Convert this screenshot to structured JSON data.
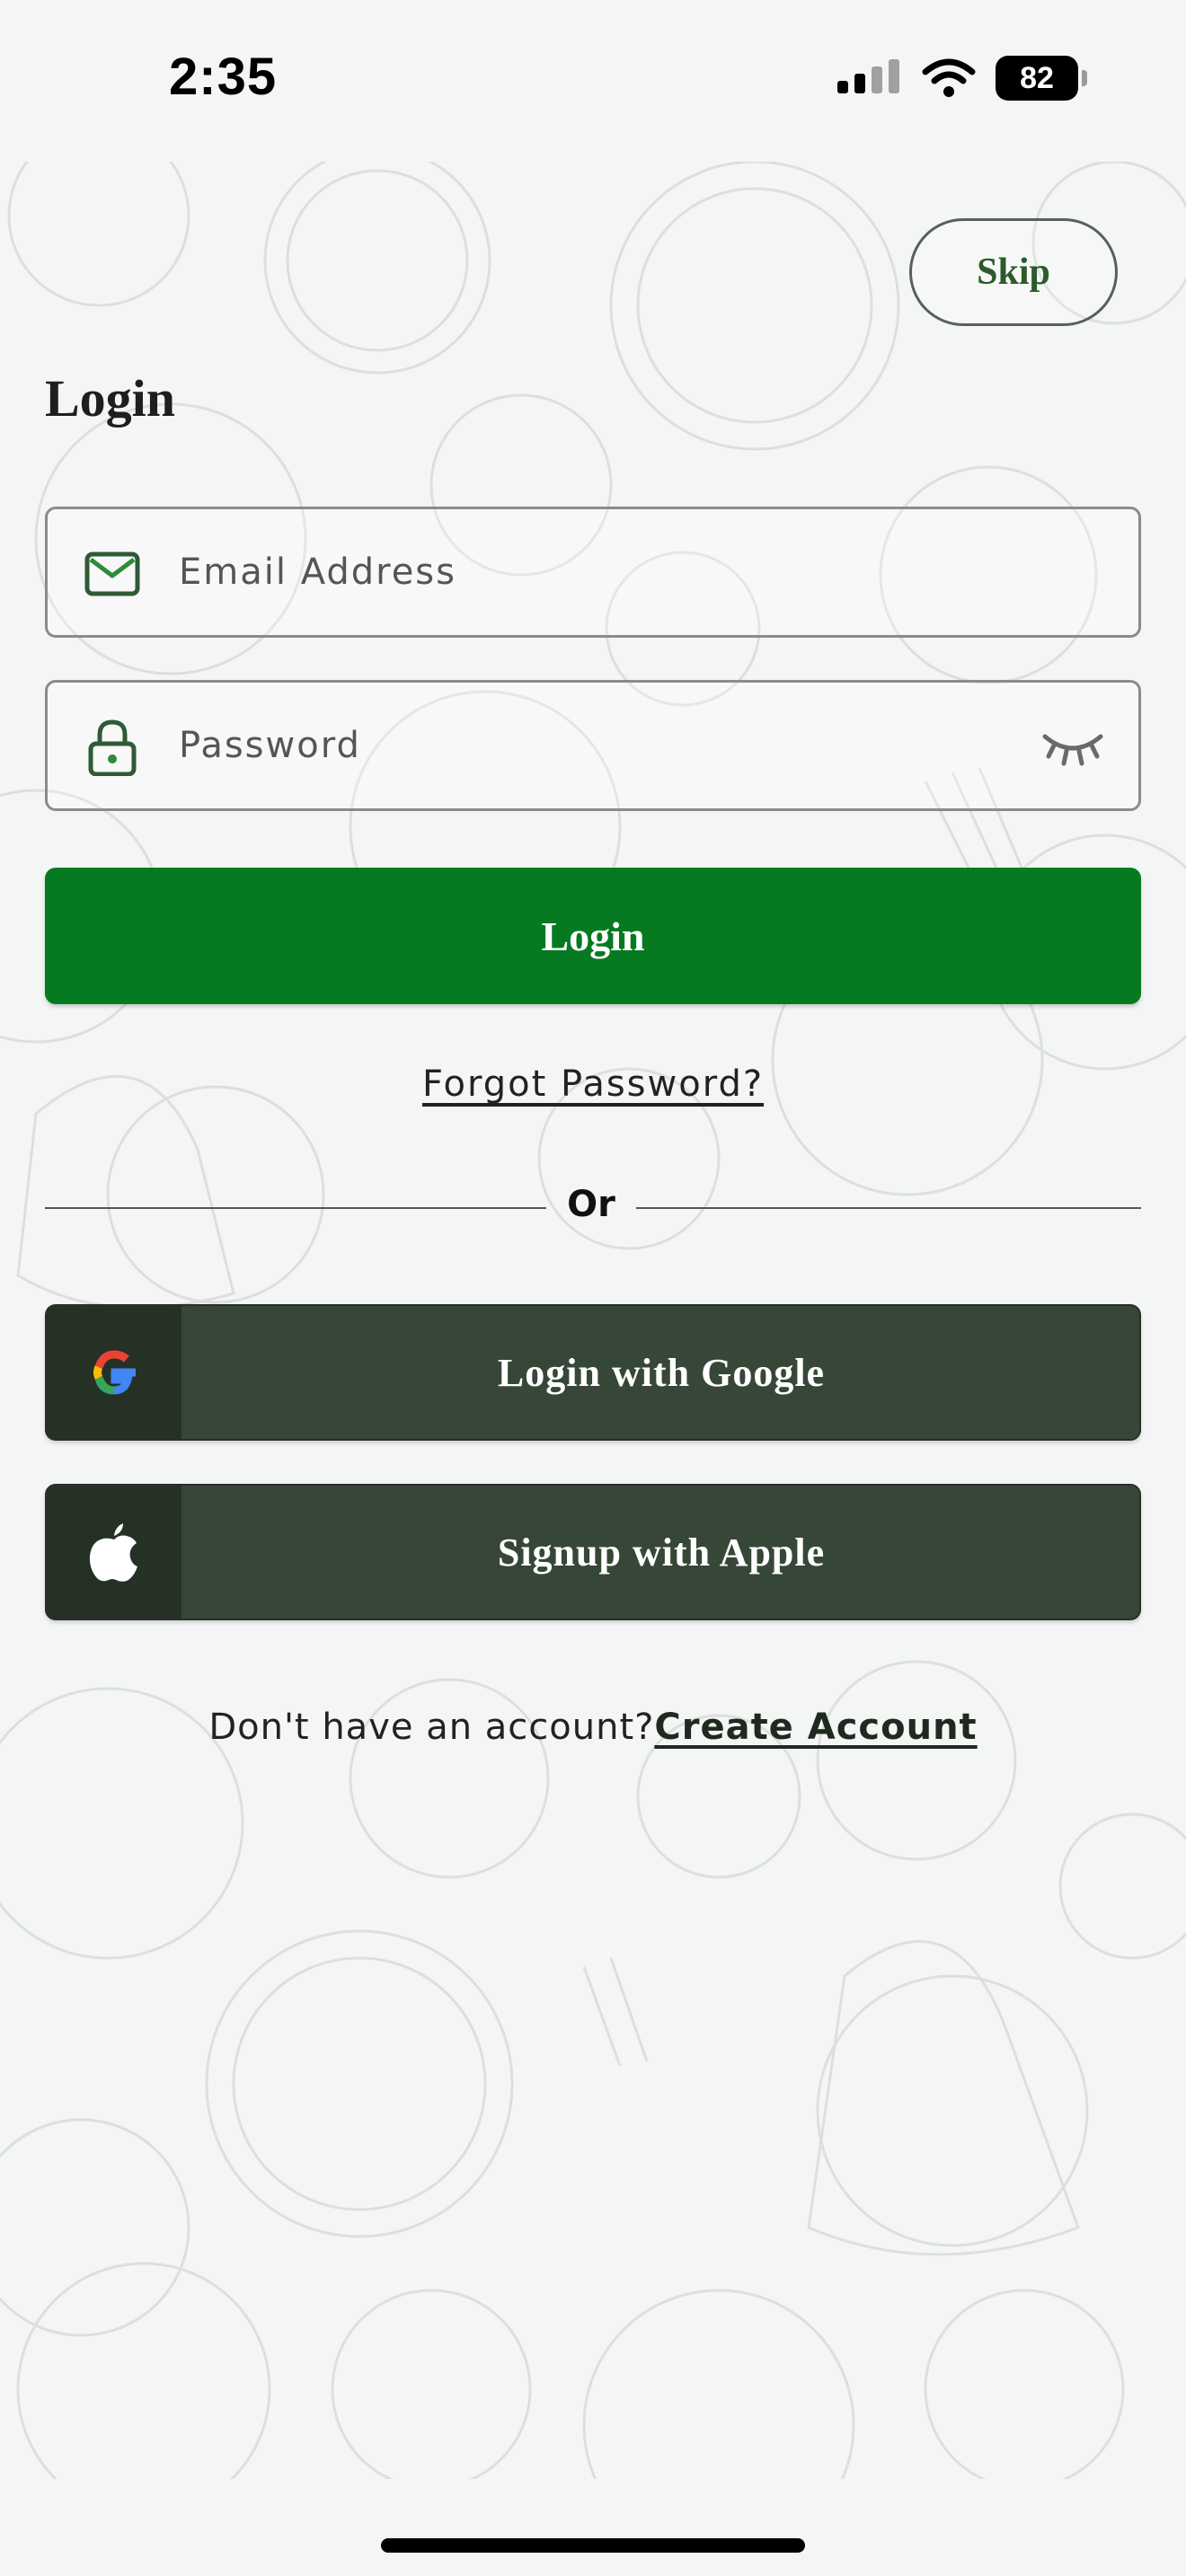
{
  "status_bar": {
    "time": "2:35",
    "battery": "82"
  },
  "header": {
    "skip_label": "Skip",
    "title": "Login"
  },
  "form": {
    "email": {
      "value": "",
      "placeholder": "Email Address",
      "icon": "mail-icon"
    },
    "password": {
      "value": "",
      "placeholder": "Password",
      "icon": "lock-icon",
      "toggle_icon": "eye-closed-icon"
    },
    "login_label": "Login",
    "forgot_label": "Forgot Password?"
  },
  "divider": {
    "label": "Or"
  },
  "social": {
    "google_label": "Login with Google",
    "google_icon": "google-icon",
    "apple_label": "Signup with Apple",
    "apple_icon": "apple-icon"
  },
  "footer": {
    "prompt": "Don't have an account?",
    "create_label": "Create Account"
  },
  "colors": {
    "background": "#f4f6f5",
    "primary_green": "#067a20",
    "social_dark": "#374737",
    "skip_text": "#2d5a2d"
  }
}
